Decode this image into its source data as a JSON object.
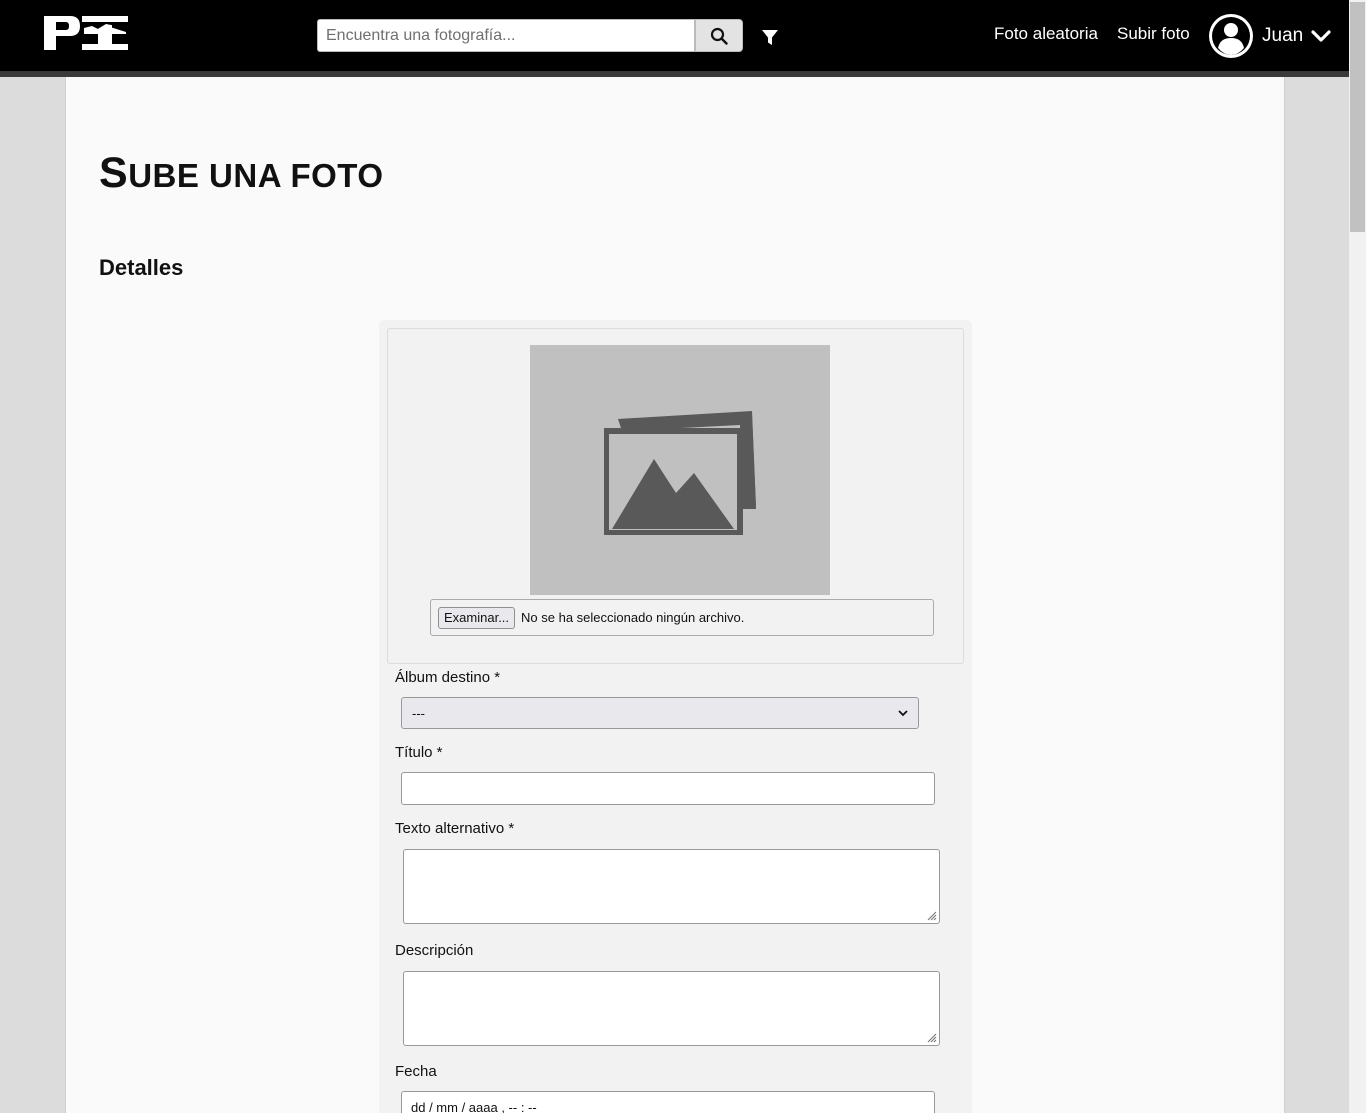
{
  "header": {
    "logo_text": "PI",
    "search_placeholder": "Encuentra una fotografía...",
    "nav": {
      "random_photo": "Foto aleatoria",
      "upload_photo": "Subir foto"
    },
    "user": {
      "name": "Juan"
    }
  },
  "page": {
    "title_first_letter": "S",
    "title_rest": "ube una foto",
    "section_title": "Detalles"
  },
  "form": {
    "file": {
      "button_label": "Examinar...",
      "status": "No se ha seleccionado ningún archivo."
    },
    "album": {
      "label": "Álbum destino *",
      "selected": "---"
    },
    "title": {
      "label": "Título *",
      "value": ""
    },
    "alt_text": {
      "label": "Texto alternativo *",
      "value": ""
    },
    "description": {
      "label": "Descripción",
      "value": ""
    },
    "date": {
      "label": "Fecha",
      "placeholder": "dd / mm / aaaa ,  -- : --"
    }
  },
  "colors": {
    "header_bg": "#000000",
    "page_bg": "#dcdcdc",
    "panel_bg": "#fafafa",
    "form_bg": "#f2f2f2",
    "preview_bg": "#c0c0c0"
  },
  "icons": {
    "search": "search-icon",
    "filter": "filter-icon",
    "avatar": "user-avatar-icon",
    "chevron": "chevron-down-icon",
    "image_placeholder": "images-placeholder-icon"
  }
}
